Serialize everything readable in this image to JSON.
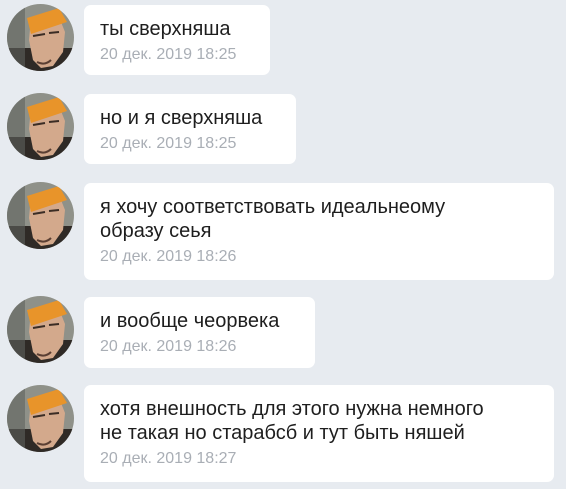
{
  "messages": [
    {
      "text": "ты сверхняша",
      "time": "20 дек. 2019 18:25"
    },
    {
      "text": "но и я сверхняша",
      "time": "20 дек. 2019 18:25"
    },
    {
      "text": "я хочу соответствовать идеальнеому\nобразу сеья",
      "time": "20 дек. 2019 18:26"
    },
    {
      "text": "и вообще чеорвека",
      "time": "20 дек. 2019 18:26"
    },
    {
      "text": "хотя внешность для этого нужна немного\nне такая но старабсб и тут быть няшей",
      "time": "20 дек. 2019 18:27"
    }
  ],
  "colors": {
    "background": "#e7ebf0",
    "bubble": "#ffffff",
    "text": "#1e1e1e",
    "timestamp": "#a9aeb5",
    "avatar_cap": "#e8942a"
  }
}
